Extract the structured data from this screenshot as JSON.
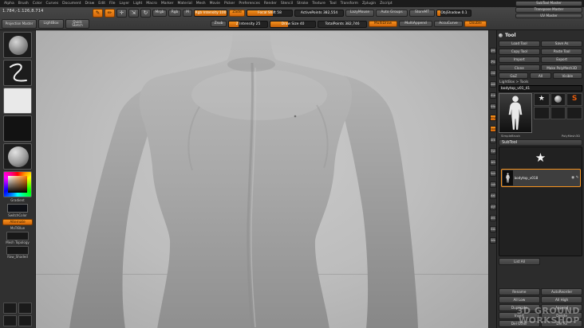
{
  "menubar": {
    "items": [
      "Alpha",
      "Brush",
      "Color",
      "Curves",
      "Document",
      "Draw",
      "Edit",
      "File",
      "Layer",
      "Light",
      "Macro",
      "Marker",
      "Material",
      "Mesh",
      "Movie",
      "Picker",
      "Preferences",
      "Render",
      "Stencil",
      "Stroke",
      "Texture",
      "Tool",
      "Transform",
      "Zplugin",
      "Zscript"
    ]
  },
  "coords_readout": "1.784,-1.126,8.714",
  "plugin_buttons": [
    "SubTool Master",
    "Transpose Master",
    "UV Master"
  ],
  "toolbar": {
    "projection_master": "Projection Master",
    "lightbox": "LightBox",
    "quick_sketch": "Quick Sketch",
    "modes": [
      {
        "name": "edit",
        "glyph": "✎",
        "active": true
      },
      {
        "name": "draw",
        "glyph": "✏",
        "active": true
      },
      {
        "name": "move",
        "glyph": "✛",
        "active": false
      },
      {
        "name": "scale",
        "glyph": "⇲",
        "active": false
      },
      {
        "name": "rotate",
        "glyph": "↻",
        "active": false
      }
    ],
    "paint_modes": [
      "Mrgb",
      "Rgb",
      "M"
    ],
    "zadd": "Zadd",
    "zsub": "Zsub",
    "sliders": {
      "rgb_label": "Rgb Intensity 100",
      "rgb_fill": "width:100%",
      "zint_label": "Z Intensity 25",
      "zint_fill": "width:25%",
      "focal_label": "Focal Shift 58",
      "focal_fill": "width:58%",
      "draw_label": "Draw Size 40",
      "draw_fill": "width:40%",
      "objshadow_label": "ObjShadow 0.1",
      "objshadow_fill": "width:10%"
    },
    "active_points": "ActivePoints 382,554",
    "total_points": "TotalPoints 382,746",
    "lazymouse": "LazyMouse",
    "auto_groups": "Auto Groups",
    "storemt": "StoreMT",
    "multidraw": "MultiDraw",
    "multiappend": "MultiAppend",
    "accucurve": "AccuCurve",
    "double": "Double"
  },
  "left_tray": {
    "gradient_label": "Gradient",
    "switch_color_label": "SwitchColor",
    "alternate_button": "Alternate",
    "motrblue_label": "MoTrBlue",
    "items": [
      {
        "label": "Mesh Topology"
      },
      {
        "label": "Raw_Shaded"
      }
    ]
  },
  "right_shelf": {
    "buttons": [
      {
        "label": "BPR",
        "active": false
      },
      {
        "label": "SPix",
        "active": false
      },
      {
        "label": "Scroll",
        "active": false
      },
      {
        "label": "Zoom",
        "active": false
      },
      {
        "label": "Actual",
        "active": false
      },
      {
        "label": "AAHalf",
        "active": false
      },
      {
        "label": "Persp",
        "active": true
      },
      {
        "label": "Floor",
        "active": true
      },
      {
        "label": "Local",
        "active": false
      },
      {
        "label": "L.Sym",
        "active": false
      },
      {
        "label": "Frame",
        "active": false
      },
      {
        "label": "Move",
        "active": false
      },
      {
        "label": "Scale",
        "active": false
      },
      {
        "label": "Rotate",
        "active": false
      },
      {
        "label": "PolyF",
        "active": false
      },
      {
        "label": "Transp",
        "active": false
      },
      {
        "label": "Ghost",
        "active": false
      },
      {
        "label": "Solo",
        "active": false
      }
    ]
  },
  "tool_panel": {
    "title": "Tool",
    "buttons": [
      "Load Tool",
      "Save As",
      "Copy Tool",
      "Paste Tool",
      "Import",
      "Export",
      "Clone",
      "Make PolyMesh3D"
    ],
    "goz_row": [
      "GoZ",
      "All",
      "Visible"
    ],
    "lightbox_tools": "LightBox > Tools",
    "current_tool_name": "bodytop_v01_41",
    "quick_labels": [
      "SimpleBrush",
      "PolyMesh3D"
    ],
    "subtool": {
      "header": "SubTool",
      "star_item_icon": "polymesh-star",
      "selected_name": "bodytop_v018",
      "list_all": "List All",
      "buttons": [
        "Rename",
        "AutoReorder",
        "All Low",
        "All High",
        "Duplicate",
        "Append",
        "Insert",
        "Delete",
        "Del Other",
        "Del All"
      ]
    }
  },
  "watermark": {
    "line1": "3D GROUND",
    "line2": "WORKSHOP"
  },
  "colors": {
    "accent": "#f6921e",
    "canvas_gray": "#bdbdbd",
    "panel_gray": "#2c2c2c"
  }
}
